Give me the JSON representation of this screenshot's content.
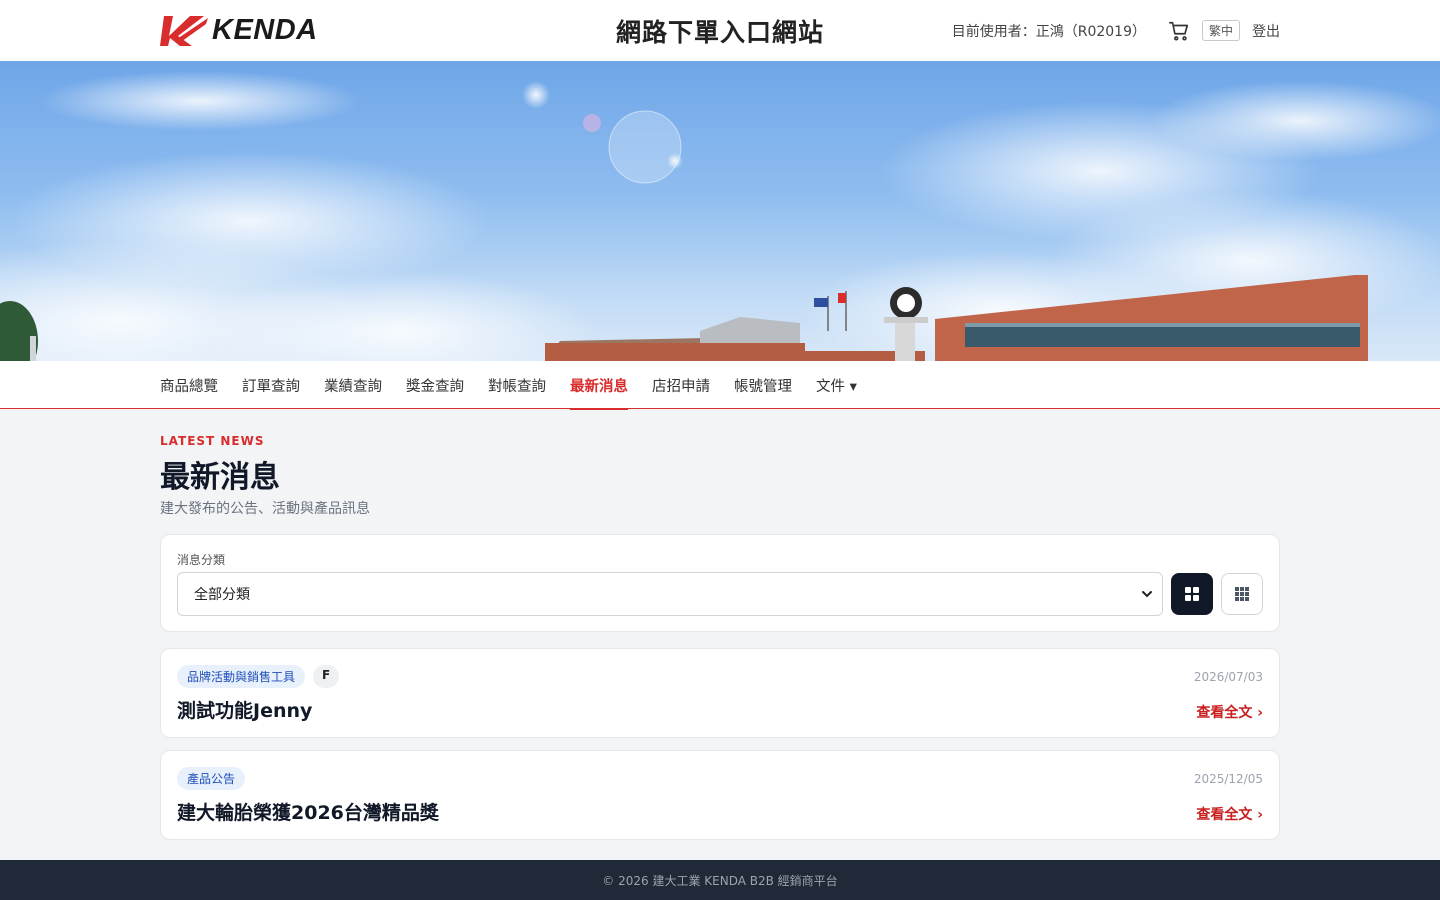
{
  "header": {
    "logo_text": "KENDA",
    "site_title": "網路下單入口網站",
    "user_label": "目前使用者：正鴻（R02019）",
    "lang": "繁中",
    "logout": "登出"
  },
  "nav": {
    "items": [
      {
        "label": "商品總覽"
      },
      {
        "label": "訂單查詢"
      },
      {
        "label": "業績查詢"
      },
      {
        "label": "獎金查詢"
      },
      {
        "label": "對帳查詢"
      },
      {
        "label": "最新消息",
        "active": true
      },
      {
        "label": "店招申請"
      },
      {
        "label": "帳號管理"
      },
      {
        "label": "文件 ▾"
      }
    ]
  },
  "page": {
    "eyebrow": "LATEST NEWS",
    "title": "最新消息",
    "subtitle": "建大發布的公告、活動與產品訊息"
  },
  "filter": {
    "label": "消息分類",
    "selected": "全部分類"
  },
  "news": [
    {
      "tags": [
        "品牌活動與銷售工具",
        "F"
      ],
      "title": "測試功能Jenny",
      "date": "2026/07/03",
      "read_more": "查看全文 ›"
    },
    {
      "tags": [
        "產品公告"
      ],
      "title": "建大輪胎榮獲2026台灣精品獎",
      "date": "2025/12/05",
      "read_more": "查看全文 ›"
    }
  ],
  "footer": {
    "text": "© 2026 建大工業 KENDA B2B 經銷商平台"
  },
  "colors": {
    "accent": "#d92c2c",
    "dark": "#111827",
    "tag_bg": "#e8f0fb",
    "tag_text": "#1e4fb8"
  }
}
